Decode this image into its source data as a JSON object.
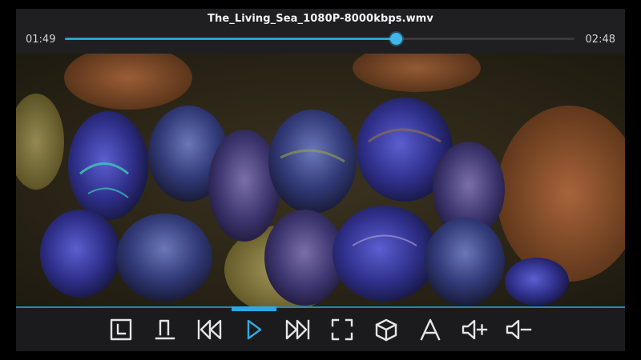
{
  "player": {
    "file_title": "The_Living_Sea_1080P-8000kbps.wmv",
    "current_time": "01:49",
    "duration": "02:48",
    "progress_fraction": 0.649,
    "accent_color": "#2a9fd6"
  },
  "controls": [
    {
      "name": "bookmark-time-button",
      "icon": "clock-square-icon"
    },
    {
      "name": "subtitle-button",
      "icon": "subtitle-icon"
    },
    {
      "name": "previous-button",
      "icon": "skip-previous-icon"
    },
    {
      "name": "play-button",
      "icon": "play-icon",
      "active": true
    },
    {
      "name": "next-button",
      "icon": "skip-next-icon"
    },
    {
      "name": "fullscreen-button",
      "icon": "fullscreen-icon"
    },
    {
      "name": "3d-mode-button",
      "icon": "cube-icon"
    },
    {
      "name": "audio-track-button",
      "icon": "letter-a-icon"
    },
    {
      "name": "volume-up-button",
      "icon": "volume-up-icon"
    },
    {
      "name": "volume-down-button",
      "icon": "volume-down-icon"
    }
  ]
}
